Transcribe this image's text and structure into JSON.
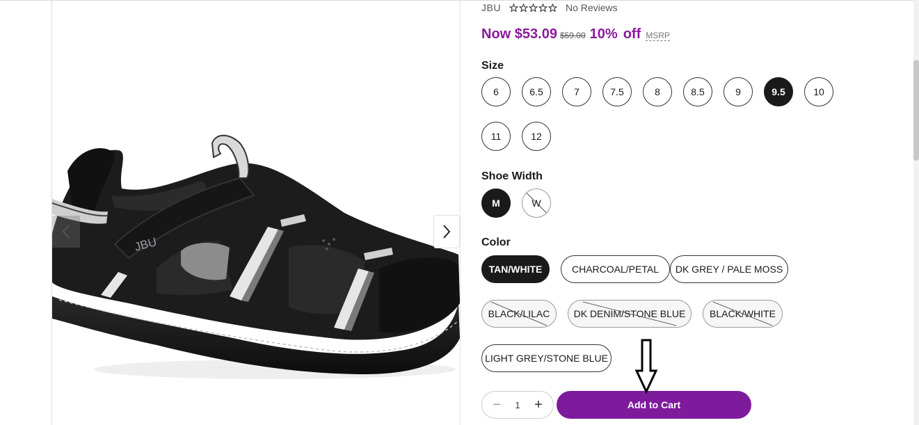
{
  "product": {
    "brand": "JBU",
    "rating_stars": 5,
    "reviews_text": "No Reviews",
    "price_now": "Now $53.09",
    "price_old": "$59.00",
    "discount": "10%",
    "discount_suffix": "off",
    "msrp_label": "MSRP"
  },
  "size": {
    "label": "Size",
    "options": [
      "6",
      "6.5",
      "7",
      "7.5",
      "8",
      "8.5",
      "9",
      "9.5",
      "10",
      "11",
      "12"
    ],
    "selected": "9.5"
  },
  "width": {
    "label": "Shoe Width",
    "options": [
      "M",
      "W"
    ],
    "selected": "M",
    "unavailable": [
      "W"
    ]
  },
  "color": {
    "label": "Color",
    "options": [
      "TAN/WHITE",
      "CHARCOAL/PETAL",
      "DK GREY / PALE MOSS",
      "BLACK/LILAC",
      "DK DENIM/STONE BLUE",
      "BLACK/WHITE",
      "LIGHT GREY/STONE BLUE"
    ],
    "selected": "TAN/WHITE",
    "unavailable": [
      "BLACK/LILAC",
      "DK DENIM/STONE BLUE",
      "BLACK/WHITE"
    ]
  },
  "cart": {
    "quantity": "1",
    "minus_symbol": "−",
    "plus_symbol": "+",
    "add_label": "Add to Cart"
  },
  "image": {
    "logo_text": "JBU",
    "prev_icon": "chevron-left-icon",
    "next_icon": "chevron-right-icon"
  },
  "colors": {
    "accent": "#7e1a9c",
    "price": "#8a1a9b",
    "selected": "#1a1a1a"
  }
}
